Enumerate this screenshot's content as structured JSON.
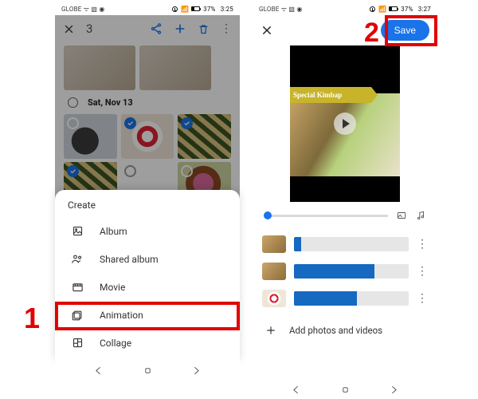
{
  "left": {
    "status": {
      "carrier": "GLOBE",
      "signal": "ᯤ ▧ ◉",
      "battery": "37%",
      "time": "3:25"
    },
    "topbar": {
      "selected_count": "3"
    },
    "date_header": "Sat, Nov 13",
    "sheet": {
      "title": "Create",
      "items": [
        {
          "key": "album",
          "label": "Album"
        },
        {
          "key": "shared-album",
          "label": "Shared album"
        },
        {
          "key": "movie",
          "label": "Movie"
        },
        {
          "key": "animation",
          "label": "Animation"
        },
        {
          "key": "collage",
          "label": "Collage"
        }
      ]
    }
  },
  "right": {
    "status": {
      "carrier": "GLOBE",
      "signal": "ᯤ ▧ ◉",
      "battery": "37%",
      "time": "3:27"
    },
    "save_label": "Save",
    "preview_caption": "Special Kimbap",
    "clips": [
      {
        "fill_pct": 6
      },
      {
        "fill_pct": 70
      },
      {
        "fill_pct": 55
      }
    ],
    "add_label": "Add photos and videos"
  },
  "callouts": {
    "one": "1",
    "two": "2"
  }
}
